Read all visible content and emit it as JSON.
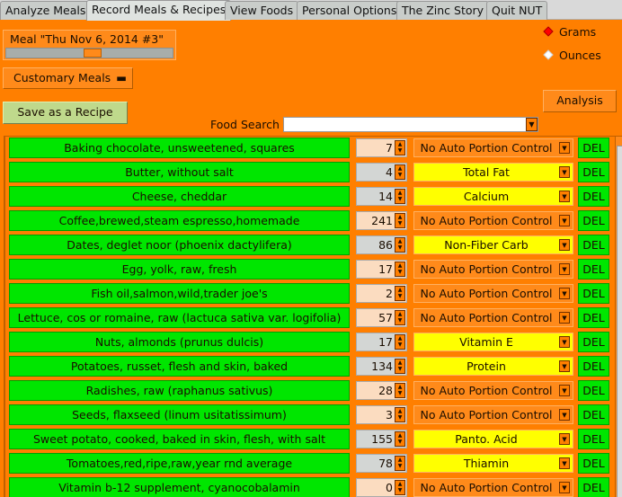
{
  "tabs": [
    "Analyze Meals",
    "Record Meals & Recipes",
    "View Foods",
    "Personal Options",
    "The Zinc Story",
    "Quit NUT"
  ],
  "selected_tab": "Record Meals & Recipes",
  "meal_label": "Meal \"Thu Nov  6, 2014 #3\"",
  "customary_meals": "Customary Meals",
  "save_recipe": "Save as a Recipe",
  "food_search_label": "Food Search",
  "food_search_value": "",
  "units": {
    "grams": "Grams",
    "ounces": "Ounces",
    "selected": "Grams"
  },
  "analysis": "Analysis",
  "del_label": "DEL",
  "colors": {
    "background": "#ff7f00",
    "food": "#00e600",
    "nutrient_target": "#ffff00"
  },
  "rows": [
    {
      "food": "Baking chocolate, unsweetened, squares",
      "qty": "7",
      "portion": "No Auto Portion Control"
    },
    {
      "food": "Butter, without salt",
      "qty": "4",
      "portion": "Total Fat"
    },
    {
      "food": "Cheese, cheddar",
      "qty": "14",
      "portion": "Calcium"
    },
    {
      "food": "Coffee,brewed,steam espresso,homemade",
      "qty": "241",
      "portion": "No Auto Portion Control"
    },
    {
      "food": "Dates, deglet noor (phoenix dactylifera)",
      "qty": "86",
      "portion": "Non-Fiber Carb"
    },
    {
      "food": "Egg, yolk, raw, fresh",
      "qty": "17",
      "portion": "No Auto Portion Control"
    },
    {
      "food": "Fish oil,salmon,wild,trader joe's",
      "qty": "2",
      "portion": "No Auto Portion Control"
    },
    {
      "food": "Lettuce, cos or romaine, raw (lactuca sativa var. logifolia)",
      "qty": "57",
      "portion": "No Auto Portion Control"
    },
    {
      "food": "Nuts, almonds (prunus dulcis)",
      "qty": "17",
      "portion": "Vitamin E"
    },
    {
      "food": "Potatoes, russet, flesh and skin, baked",
      "qty": "134",
      "portion": "Protein"
    },
    {
      "food": "Radishes, raw (raphanus sativus)",
      "qty": "28",
      "portion": "No Auto Portion Control"
    },
    {
      "food": "Seeds, flaxseed (linum usitatissimum)",
      "qty": "3",
      "portion": "No Auto Portion Control"
    },
    {
      "food": "Sweet potato, cooked, baked in skin, flesh, with salt",
      "qty": "155",
      "portion": "Panto. Acid"
    },
    {
      "food": "Tomatoes,red,ripe,raw,year rnd average",
      "qty": "78",
      "portion": "Thiamin"
    },
    {
      "food": "Vitamin b-12 supplement, cyanocobalamin",
      "qty": "0",
      "portion": "No Auto Portion Control"
    }
  ]
}
